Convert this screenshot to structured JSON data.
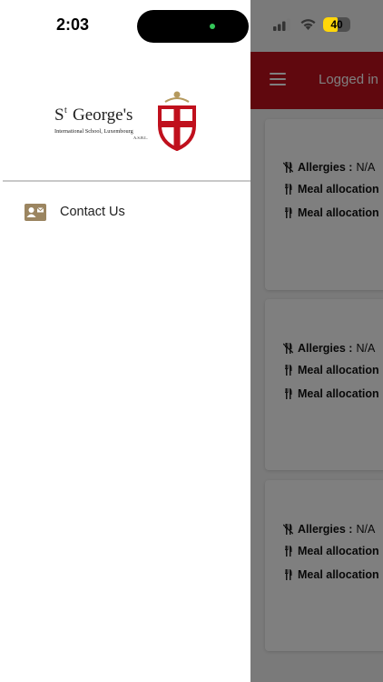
{
  "status_bar": {
    "time": "2:03",
    "battery": "40"
  },
  "app_bar": {
    "title": "Logged in"
  },
  "cards": [
    {
      "allergies_label": "Allergies :",
      "allergies_value": "N/A",
      "meal1": "Meal allocation",
      "meal2": "Meal allocation"
    },
    {
      "allergies_label": "Allergies :",
      "allergies_value": "N/A",
      "meal1": "Meal allocation",
      "meal2": "Meal allocation"
    },
    {
      "allergies_label": "Allergies :",
      "allergies_value": "N/A",
      "meal1": "Meal allocation",
      "meal2": "Meal allocation"
    }
  ],
  "drawer": {
    "logo": {
      "name_line1": "St George's",
      "name_line2": "International School, Luxembourg",
      "name_line3": "A.S.B.L."
    },
    "items": [
      {
        "label": "Contact Us",
        "icon": "contact-card-icon"
      }
    ]
  },
  "colors": {
    "brand_red": "#c0101d",
    "drawer_icon": "#9b8560",
    "battery_yellow": "#ffd60a"
  }
}
